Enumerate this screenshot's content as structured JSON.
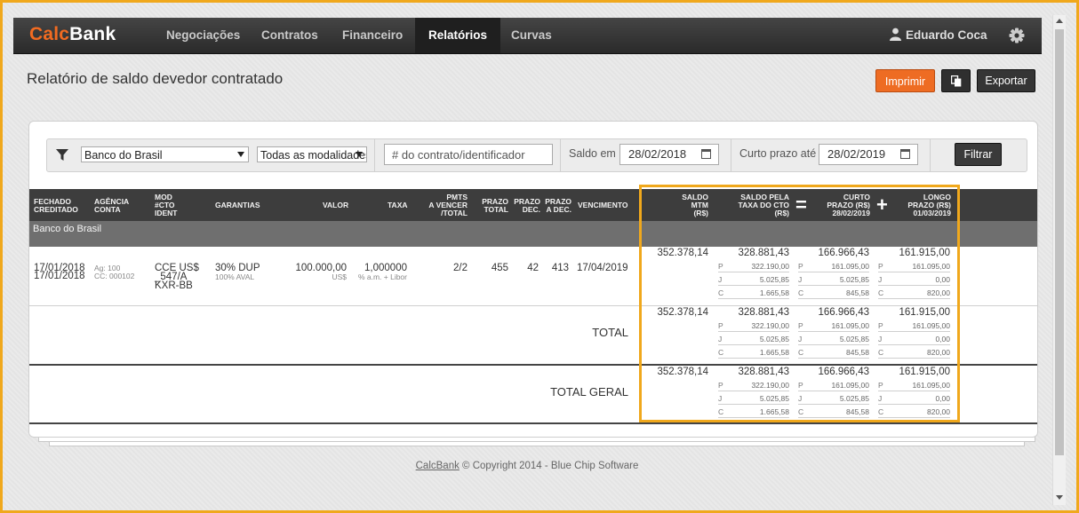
{
  "brand": {
    "part1": "Calc",
    "part2": "Bank"
  },
  "nav": {
    "items": [
      "Negociações",
      "Contratos",
      "Financeiro",
      "Relatórios",
      "Curvas"
    ],
    "active": "Relatórios"
  },
  "user": {
    "name": "Eduardo Coca",
    "icon": "user-icon"
  },
  "settings": {
    "icon": "gear-icon"
  },
  "page": {
    "title": "Relatório de saldo devedor contratado"
  },
  "actions": {
    "print": "Imprimir",
    "copy_icon": "copy-icon",
    "export": "Exportar"
  },
  "colors": {
    "accent": "#ee6c23",
    "highlight": "#f0a81c",
    "header_bg": "#3d3d3d",
    "bank_row_bg": "#6f6f6f"
  },
  "filters": {
    "bank": "Banco do Brasil",
    "modality": "Todas as modalidades",
    "contract_placeholder": "# do contrato/identificador",
    "saldo_label": "Saldo em",
    "saldo_date": "28/02/2018",
    "curto_label": "Curto prazo até",
    "curto_date": "28/02/2019",
    "button": "Filtrar"
  },
  "table": {
    "headers": {
      "fechado": [
        "Fechado",
        "Creditado"
      ],
      "agencia": [
        "Agência",
        "Conta"
      ],
      "mod": [
        "Mod",
        "#CTO",
        "Ident"
      ],
      "garantias": [
        "Garantias"
      ],
      "valor": [
        "Valor"
      ],
      "taxa": [
        "Taxa"
      ],
      "pmts": [
        "PMTs",
        "a vencer",
        "/total"
      ],
      "prazo_total": [
        "Prazo",
        "total"
      ],
      "prazo_dec": [
        "Prazo",
        "dec."
      ],
      "prazo_adec": [
        "Prazo",
        "a dec."
      ],
      "vencimento": [
        "Vencimento"
      ],
      "saldo_mtm": [
        "Saldo",
        "MTM",
        "(R$)"
      ],
      "saldo_taxa": [
        "Saldo pela",
        "taxa do CTO",
        "(R$)"
      ],
      "curto": [
        "Curto",
        "prazo (R$)",
        "28/02/2019"
      ],
      "longo": [
        "Longo",
        "prazo (R$)",
        "01/03/2019"
      ]
    },
    "group": "Banco do Brasil",
    "row": {
      "fechado": "17/01/2018",
      "creditado": "17/01/2018",
      "ag": "Ag: 100",
      "cc": "CC: 000102",
      "mod": "CCE US$",
      "cto": "_547/A",
      "ident": "KXR-BB",
      "garantia": "30% DUP",
      "garantia_sub": "100% AVAL",
      "valor": "100.000,00",
      "valor_sub": "US$",
      "taxa": "1,000000",
      "taxa_sub": "% a.m. + Libor",
      "pmts": "2/2",
      "prazo_total": "455",
      "prazo_dec": "42",
      "prazo_adec": "413",
      "vencimento": "17/04/2019"
    },
    "total_label": "TOTAL",
    "total_geral_label": "TOTAL GERAL",
    "values": {
      "mtm": "352.378,14",
      "taxa": {
        "total": "328.881,43",
        "p": "322.190,00",
        "j": "5.025,85",
        "c": "1.665,58"
      },
      "curto": {
        "total": "166.966,43",
        "p": "161.095,00",
        "j": "5.025,85",
        "c": "845,58"
      },
      "longo": {
        "total": "161.915,00",
        "p": "161.095,00",
        "j": "0,00",
        "c": "820,00"
      }
    },
    "sub_labels": {
      "p": "P",
      "j": "J",
      "c": "C"
    },
    "operators": {
      "eq": "=",
      "plus": "+"
    }
  },
  "footer": {
    "link": "CalcBank",
    "text": " © Copyright 2014 - Blue Chip Software"
  }
}
